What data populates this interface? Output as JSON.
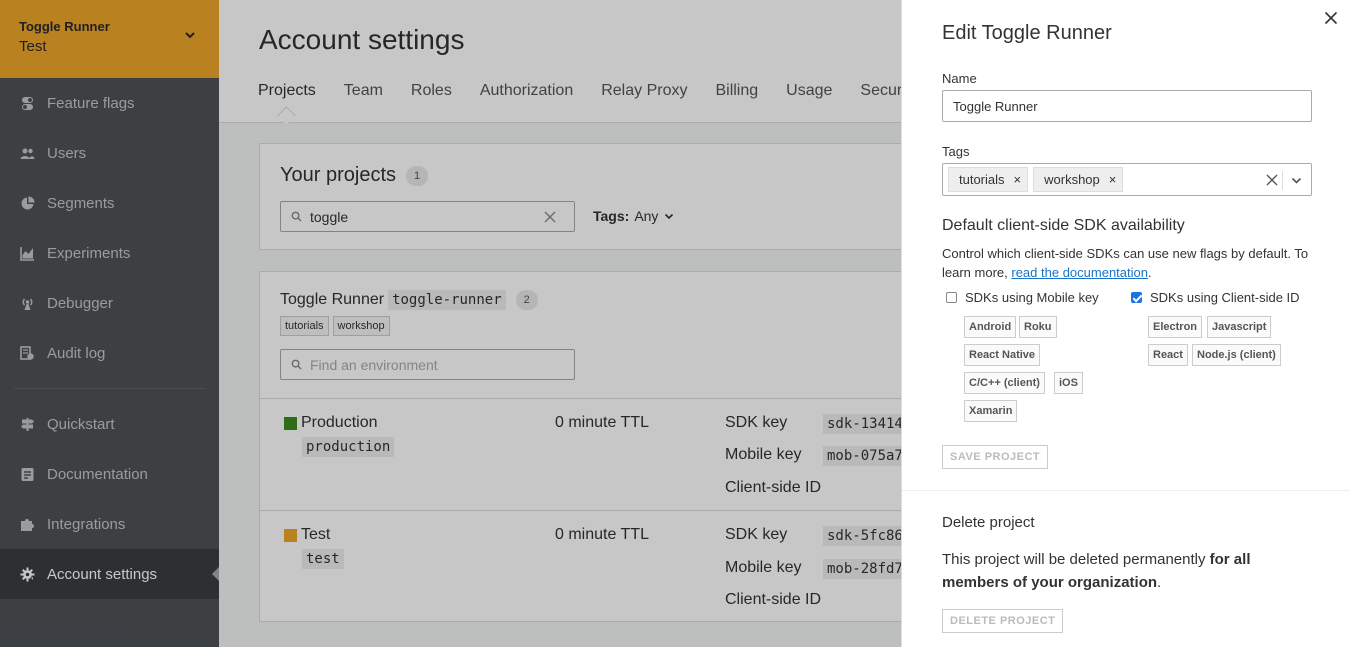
{
  "sidebar": {
    "project_name": "Toggle Runner",
    "environment": "Test",
    "items": [
      {
        "label": "Feature flags",
        "icon": "toggle-icon"
      },
      {
        "label": "Users",
        "icon": "users-icon"
      },
      {
        "label": "Segments",
        "icon": "pie-icon"
      },
      {
        "label": "Experiments",
        "icon": "chart-icon"
      },
      {
        "label": "Debugger",
        "icon": "antenna-icon"
      },
      {
        "label": "Audit log",
        "icon": "audit-icon"
      },
      {
        "label": "Quickstart",
        "icon": "signpost-icon"
      },
      {
        "label": "Documentation",
        "icon": "doc-icon"
      },
      {
        "label": "Integrations",
        "icon": "puzzle-icon"
      },
      {
        "label": "Account settings",
        "icon": "gear-icon"
      }
    ]
  },
  "main": {
    "title": "Account settings",
    "tabs": [
      "Projects",
      "Team",
      "Roles",
      "Authorization",
      "Relay Proxy",
      "Billing",
      "Usage",
      "Securit"
    ],
    "projects_card": {
      "title": "Your projects",
      "count": "1",
      "search_value": "toggle",
      "tags_label": "Tags:",
      "tags_value": "Any"
    },
    "project": {
      "name": "Toggle Runner",
      "key": "toggle-runner",
      "env_count": "2",
      "tags": [
        "tutorials",
        "workshop"
      ],
      "env_search_placeholder": "Find an environment",
      "environments": [
        {
          "name": "Production",
          "key": "production",
          "color": "#3d8b22",
          "ttl": "0 minute TTL",
          "sdk_label": "SDK key",
          "sdk_value": "sdk-13414",
          "mobile_label": "Mobile key",
          "mobile_value": "mob-075a7",
          "client_label": "Client-side ID"
        },
        {
          "name": "Test",
          "key": "test",
          "color": "#efa629",
          "ttl": "0 minute TTL",
          "sdk_label": "SDK key",
          "sdk_value": "sdk-5fc86",
          "mobile_label": "Mobile key",
          "mobile_value": "mob-28fd7",
          "client_label": "Client-side ID"
        }
      ]
    }
  },
  "panel": {
    "title": "Edit Toggle Runner",
    "name_label": "Name",
    "name_value": "Toggle Runner",
    "tags_label": "Tags",
    "tags": [
      "tutorials",
      "workshop"
    ],
    "sdk_section_title": "Default client-side SDK availability",
    "sdk_desc_1": "Control which client-side SDKs can use new flags by default. To learn more, ",
    "sdk_desc_link": "read the documentation",
    "sdk_desc_2": ".",
    "mobile_label": "SDKs using Mobile key",
    "mobile_checked": false,
    "mobile_sdks": [
      "Android",
      "Roku",
      "React Native",
      "C/C++ (client)",
      "iOS",
      "Xamarin"
    ],
    "client_label": "SDKs using Client-side ID",
    "client_checked": true,
    "client_sdks": [
      "Electron",
      "Javascript",
      "React",
      "Node.js (client)"
    ],
    "save_button": "SAVE PROJECT",
    "delete_title": "Delete project",
    "delete_text_1": "This project will be deleted permanently ",
    "delete_text_bold": "for all members of your organization",
    "delete_text_2": ".",
    "delete_button": "DELETE PROJECT"
  },
  "colors": {
    "accent": "#efa629",
    "sidebar_bg": "#4d5257",
    "link": "#1a73c8",
    "checkbox": "#1a73e8"
  }
}
